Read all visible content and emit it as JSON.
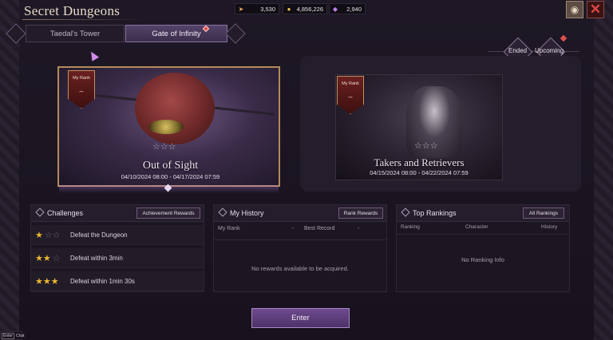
{
  "header": {
    "title": "Secret Dungeons"
  },
  "currencies": [
    {
      "icon": "arrow-icon",
      "value": "3,530"
    },
    {
      "icon": "gold-coin-icon",
      "value": "4,856,226"
    },
    {
      "icon": "crystal-icon",
      "value": "2,940"
    }
  ],
  "tabs": [
    {
      "label": "Taedal's Tower",
      "active": false
    },
    {
      "label": "Gate of Infinity",
      "active": true
    }
  ],
  "filters": {
    "ended": "Ended",
    "upcoming": "Upcoming"
  },
  "cards": [
    {
      "rank_title": "My Rank",
      "rank_value": "–",
      "stars": "☆☆☆",
      "name": "Out of Sight",
      "dates": "04/10/2024 08:00 - 04/17/2024 07:59"
    },
    {
      "rank_title": "My Rank",
      "rank_value": "–",
      "stars": "☆☆☆",
      "name": "Takers and Retrievers",
      "dates": "04/15/2024 08:00 - 04/22/2024 07:59"
    }
  ],
  "challenges": {
    "title": "Challenges",
    "button": "Achievement Rewards",
    "items": [
      {
        "stars_on": "★",
        "stars_off": "☆☆",
        "label": "Defeat the Dungeon"
      },
      {
        "stars_on": "★★",
        "stars_off": "☆",
        "label": "Defeat within 3min"
      },
      {
        "stars_on": "★★★",
        "stars_off": "",
        "label": "Defeat within 1min 30s"
      }
    ]
  },
  "history": {
    "title": "My History",
    "button": "Rank Rewards",
    "my_rank_label": "My Rank",
    "my_rank_value": "-",
    "best_record_label": "Best Record",
    "best_record_value": "-",
    "message": "No rewards available to be acquired."
  },
  "rankings": {
    "title": "Top Rankings",
    "button": "All Rankings",
    "col_ranking": "Ranking",
    "col_character": "Character",
    "col_history": "History",
    "message": "No Ranking Info"
  },
  "enter_label": "Enter",
  "corner": {
    "key": "Enter",
    "label": "Chat"
  },
  "colors": {
    "accent": "#6e4a8e",
    "star_gold": "#e8b830",
    "notification": "#e05050",
    "close": "#e04848"
  }
}
